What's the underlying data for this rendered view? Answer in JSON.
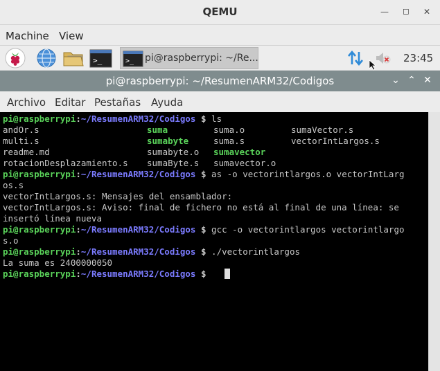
{
  "qemu": {
    "title": "QEMU",
    "menu": [
      "Machine",
      "View"
    ]
  },
  "panel": {
    "launchers": [
      "raspberry-menu-icon",
      "globe-icon",
      "folder-icon",
      "terminal-icon"
    ],
    "task_label": "pi@raspberrypi: ~/Re...",
    "clock": "23:45"
  },
  "terminal": {
    "title": "pi@raspberrypi: ~/ResumenARM32/Codigos",
    "menu": [
      "Archivo",
      "Editar",
      "Pestañas",
      "Ayuda"
    ],
    "prompt": {
      "user": "pi@raspberrypi",
      "colon": ":",
      "path": "~/ResumenARM32/Codigos",
      "dollar": " $"
    },
    "commands": {
      "ls": " ls",
      "as_a": " as -o vectorintlargos.o vectorIntLarg",
      "as_b": "os.s",
      "gcc_a": " gcc -o vectorintlargos vectorintlargo",
      "gcc_b": "s.o",
      "run": " ./vectorintlargos"
    },
    "ls_output": [
      [
        "andOr.s",
        "suma",
        "suma.o",
        "sumaVector.s"
      ],
      [
        "multi.s",
        "sumabyte",
        "suma.s",
        "vectorIntLargos.s"
      ],
      [
        "readme.md",
        "sumabyte.o",
        "sumavector",
        ""
      ],
      [
        "rotacionDesplazamiento.s",
        "sumaByte.s",
        "sumavector.o",
        ""
      ]
    ],
    "as_output": [
      "vectorIntLargos.s: Mensajes del ensamblador:",
      "vectorIntLargos.s: Aviso: final de fichero no está al final de una línea: se",
      "insertó línea nueva"
    ],
    "run_output": "La suma es 2400000050"
  }
}
